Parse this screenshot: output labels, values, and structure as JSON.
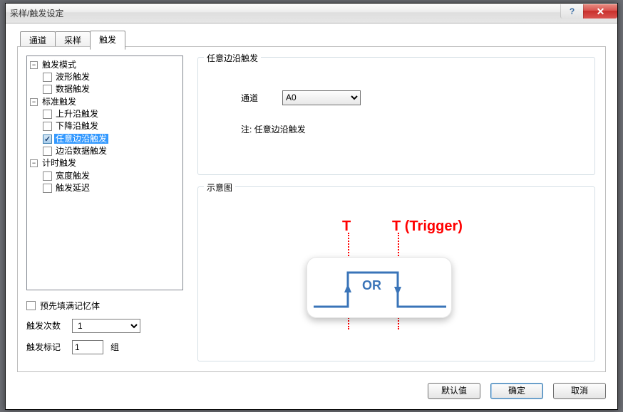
{
  "window": {
    "title": "采样/触发设定"
  },
  "tabs": {
    "channel": "通道",
    "sample": "采样",
    "trigger": "触发"
  },
  "tree": {
    "mode": {
      "label": "触发模式",
      "waveform": "波形触发",
      "data": "数据触发"
    },
    "standard": {
      "label": "标准触发",
      "rising": "上升沿触发",
      "falling": "下降沿触发",
      "anyedge": "任意边沿触发",
      "edgedata": "边沿数据触发"
    },
    "timed": {
      "label": "计时触发",
      "width": "宽度触发",
      "delay": "触发延迟"
    }
  },
  "bottomLeft": {
    "prefill": "预先填满记忆体",
    "countLabel": "触发次数",
    "countValue": "1",
    "markLabel": "触发标记",
    "markValue": "1",
    "markUnit": "组"
  },
  "gb1": {
    "legend": "任意边沿触发",
    "channelLabel": "通道",
    "channelValue": "A0",
    "note": "注: 任意边沿触发"
  },
  "gb2": {
    "legend": "示意图",
    "t1": "T",
    "t2": "T (Trigger)",
    "or": "OR"
  },
  "buttons": {
    "defaults": "默认值",
    "ok": "确定",
    "cancel": "取消"
  }
}
